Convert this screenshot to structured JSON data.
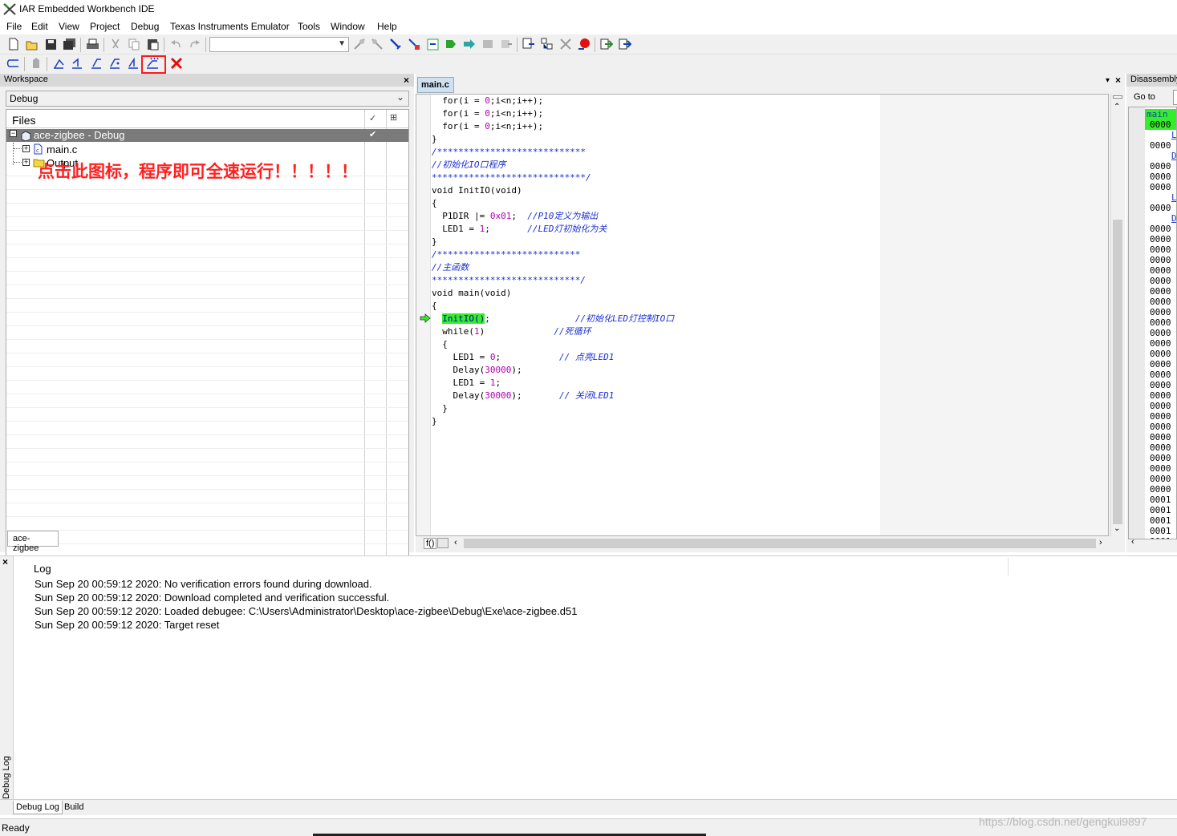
{
  "app": {
    "title": "IAR Embedded Workbench IDE"
  },
  "menu": [
    "File",
    "Edit",
    "View",
    "Project",
    "Debug",
    "Texas Instruments Emulator",
    "Tools",
    "Window",
    "Help"
  ],
  "workspace": {
    "panel_title": "Workspace",
    "config": "Debug",
    "files_header": "Files",
    "project": "ace-zigbee - Debug",
    "file1": "main.c",
    "folder1": "Output",
    "tab": "ace-zigbee"
  },
  "annotation": {
    "text": "点击此图标，程序即可全速运行！！！！！",
    "color": "#ff2020"
  },
  "editor": {
    "tab": "main.c",
    "lines": [
      [
        "  for(i = ",
        "0",
        ";i<n;i++);",
        ""
      ],
      [
        "  for(i = ",
        "0",
        ";i<n;i++);",
        ""
      ],
      [
        "  for(i = ",
        "0",
        ";i<n;i++);",
        ""
      ],
      [
        "}",
        "",
        "",
        ""
      ],
      [
        "",
        "",
        "",
        "/****************************"
      ],
      [
        "",
        "",
        "",
        "//初始化IO口程序"
      ],
      [
        "",
        "",
        "",
        "*****************************/"
      ],
      [
        "void InitIO(void)",
        "",
        "",
        ""
      ],
      [
        "{",
        "",
        "",
        ""
      ],
      [
        "  P1DIR |= ",
        "0x01",
        ";  ",
        "//P10定义为输出"
      ],
      [
        "  LED1 = ",
        "1",
        ";       ",
        "//LED灯初始化为关"
      ],
      [
        "}",
        "",
        "",
        ""
      ],
      [
        "",
        "",
        "",
        "/***************************"
      ],
      [
        "",
        "",
        "",
        "//主函数"
      ],
      [
        "",
        "",
        "",
        "****************************/"
      ],
      [
        "void main(void)",
        "",
        "",
        ""
      ],
      [
        "{",
        "",
        "",
        ""
      ],
      [
        "  ",
        "",
        "",
        ""
      ],
      [
        "  while(",
        "1",
        ")             ",
        "//死循环"
      ],
      [
        "  {",
        "",
        "",
        ""
      ],
      [
        "    LED1 = ",
        "0",
        ";           ",
        "// 点亮LED1"
      ],
      [
        "    Delay(",
        "30000",
        ");",
        ""
      ],
      [
        "    LED1 = ",
        "1",
        ";",
        ""
      ],
      [
        "    Delay(",
        "30000",
        ");       ",
        "// 关闭LED1"
      ],
      [
        "  }",
        "",
        "",
        ""
      ],
      [
        "}",
        "",
        "",
        ""
      ]
    ],
    "current_call": "InitIO()",
    "current_rest": ";",
    "current_comment": "//初始化LED灯控制IO口",
    "hscroll_label": "f()"
  },
  "disassembly": {
    "title": "Disassembly",
    "goto": "Go to",
    "first": "main",
    "rows": [
      "0000",
      "",
      "0000",
      "",
      "0000",
      "0000",
      "0000",
      "",
      "0000",
      "",
      "0000",
      "0000",
      "0000",
      "0000",
      "0000",
      "0000",
      "0000",
      "0000",
      "0000",
      "0000",
      "0000",
      "0000",
      "0000",
      "0000",
      "0000",
      "0000",
      "0000",
      "0000",
      "0000",
      "0000",
      "0000",
      "0000",
      "0000",
      "0000",
      "0000",
      "0000",
      "0001",
      "0001",
      "0001",
      "0001",
      "0001"
    ],
    "labels": [
      "L",
      "D",
      "L",
      "D"
    ]
  },
  "log": {
    "header": "Log",
    "lines": [
      "Sun Sep 20 00:59:12 2020: No verification errors found during download.",
      "Sun Sep 20 00:59:12 2020: Download completed and verification successful.",
      "Sun Sep 20 00:59:12 2020: Loaded debugee: C:\\Users\\Administrator\\Desktop\\ace-zigbee\\Debug\\Exe\\ace-zigbee.d51",
      "Sun Sep 20 00:59:12 2020: Target reset"
    ],
    "side_label": "Debug Log",
    "tabs": [
      "Debug Log",
      "Build"
    ]
  },
  "status": {
    "text": "Ready",
    "watermark": "https://blog.csdn.net/gengkui9897"
  }
}
